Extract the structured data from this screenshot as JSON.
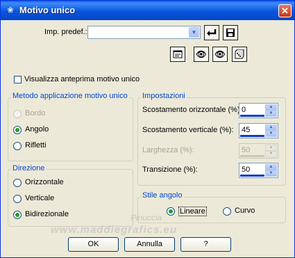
{
  "window": {
    "title": "Motivo unico",
    "app_icon": "paint-shop-pro-icon",
    "close_icon": "close-icon"
  },
  "toolbar": {
    "preset_label": "Imp. predef.:",
    "preset_value": "",
    "icons": [
      "reset-icon",
      "save-preset-icon",
      "dialog-options-icon",
      "randomize-icon",
      "preview-toggle-icon",
      "dice-icon"
    ]
  },
  "preview_checkbox": {
    "label": "Visualizza anteprima motivo unico",
    "checked": false
  },
  "method_group": {
    "legend": "Metodo applicazione motivo unico",
    "options": [
      {
        "label": "Bordo",
        "selected": false,
        "disabled": true
      },
      {
        "label": "Angolo",
        "selected": true,
        "disabled": false
      },
      {
        "label": "Rifletti",
        "selected": false,
        "disabled": false
      }
    ]
  },
  "direction_group": {
    "legend": "Direzione",
    "options": [
      {
        "label": "Orizzontale",
        "selected": false
      },
      {
        "label": "Verticale",
        "selected": false
      },
      {
        "label": "Bidirezionale",
        "selected": true
      }
    ]
  },
  "settings_group": {
    "legend": "Impostazioni",
    "fields": [
      {
        "label": "Scostamento orizzontale (%):",
        "value": "0",
        "disabled": false
      },
      {
        "label": "Scostamento verticale (%):",
        "value": "45",
        "disabled": false
      },
      {
        "label": "Larghezza (%):",
        "value": "50",
        "disabled": true
      },
      {
        "label": "Transizione (%):",
        "value": "50",
        "disabled": false
      }
    ]
  },
  "corner_style_group": {
    "legend": "Stile angolo",
    "options": [
      {
        "label": "Lineare",
        "selected": true
      },
      {
        "label": "Curvo",
        "selected": false
      }
    ]
  },
  "buttons": {
    "ok": "OK",
    "cancel": "Annulla",
    "help": "?"
  },
  "watermark": {
    "line1": "Pinuccia",
    "line2": "www.maddiegrafics.eu"
  },
  "colors": {
    "titlebar": "#0a55dc",
    "dialog_bg": "#ece9d8",
    "legend_text": "#0046d5",
    "radio_dot": "#21a121"
  }
}
